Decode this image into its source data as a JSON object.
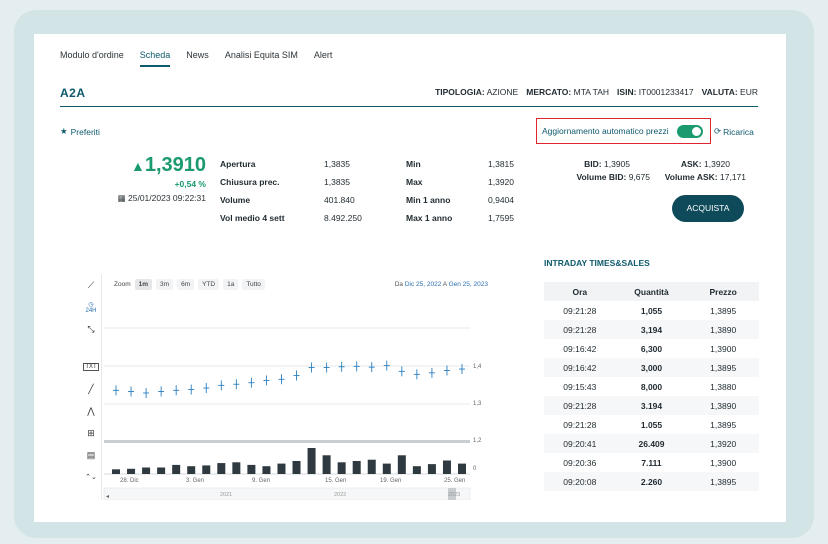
{
  "tabs": [
    "Modulo d'ordine",
    "Scheda",
    "News",
    "Analisi Equita SIM",
    "Alert"
  ],
  "active_tab": "Scheda",
  "close_icon": "close-icon",
  "stock": {
    "name": "A2A",
    "tipologia_label": "TIPOLOGIA:",
    "tipologia": "AZIONE",
    "mercato_label": "MERCATO:",
    "mercato": "MTA TAH",
    "isin_label": "ISIN:",
    "isin": "IT0001233417",
    "valuta_label": "VALUTA:",
    "valuta": "EUR"
  },
  "preferiti": "Preferiti",
  "auto_update_label": "Aggiornamento automatico prezzi",
  "auto_update_on": true,
  "ricarica": "Ricarica",
  "price": {
    "arrow": "▲",
    "value": "1,3910",
    "change": "+0,54 %",
    "timestamp": "25/01/2023 09:22:31"
  },
  "stats": [
    {
      "l1": "Apertura",
      "v1": "1,3835",
      "l2": "Min",
      "v2": "1,3815"
    },
    {
      "l1": "Chiusura prec.",
      "v1": "1,3835",
      "l2": "Max",
      "v2": "1,3920"
    },
    {
      "l1": "Volume",
      "v1": "401.840",
      "l2": "Min 1 anno",
      "v2": "0,9404"
    },
    {
      "l1": "Vol medio 4 sett",
      "v1": "8.492.250",
      "l2": "Max 1 anno",
      "v2": "1,7595"
    }
  ],
  "bidask": {
    "bid_label": "BID:",
    "bid": "1,3905",
    "ask_label": "ASK:",
    "ask": "1,3920",
    "vol_bid_label": "Volume BID:",
    "vol_bid": "9,675",
    "vol_ask_label": "Volume ASK:",
    "vol_ask": "17,171"
  },
  "buy_button": "ACQUISTA",
  "chart": {
    "zoom_label": "Zoom",
    "zoom_options": [
      "1m",
      "3m",
      "6m",
      "YTD",
      "1a",
      "Tutto"
    ],
    "zoom_active": "1m",
    "range_from_label": "Da",
    "range_from": "Dic 25, 2022",
    "range_to_label": "A",
    "range_to": "Gen 25, 2023",
    "tool_24h": "24H",
    "tool_txt": "TXT",
    "y_ticks": [
      "1,4",
      "1,3",
      "1,2"
    ],
    "vol_tick": "0",
    "x_ticks": [
      "28. Dic",
      "3. Gen",
      "9. Gen",
      "15. Gen",
      "19. Gen",
      "25. Gen"
    ],
    "nav_years": [
      "2021",
      "2022",
      "2023"
    ],
    "price_points": [
      1.336,
      1.333,
      1.329,
      1.333,
      1.336,
      1.338,
      1.342,
      1.349,
      1.352,
      1.356,
      1.362,
      1.365,
      1.375,
      1.396,
      1.396,
      1.398,
      1.399,
      1.397,
      1.401,
      1.386,
      1.378,
      1.382,
      1.388,
      1.392
    ],
    "volumes": [
      0.18,
      0.2,
      0.25,
      0.25,
      0.35,
      0.3,
      0.33,
      0.42,
      0.45,
      0.35,
      0.3,
      0.4,
      0.5,
      1.0,
      0.72,
      0.45,
      0.5,
      0.55,
      0.4,
      0.72,
      0.3,
      0.38,
      0.52,
      0.4
    ]
  },
  "intraday": {
    "title": "INTRADAY TIMES&SALES",
    "headers": [
      "Ora",
      "Quantità",
      "Prezzo"
    ],
    "rows": [
      [
        "09:21:28",
        "1,055",
        "1,3895"
      ],
      [
        "09:21:28",
        "3,194",
        "1,3890"
      ],
      [
        "09:16:42",
        "6,300",
        "1,3900"
      ],
      [
        "09:16:42",
        "3,000",
        "1,3895"
      ],
      [
        "09:15:43",
        "8,000",
        "1,3880"
      ],
      [
        "09:21:28",
        "3.194",
        "1,3890"
      ],
      [
        "09:21:28",
        "1.055",
        "1,3895"
      ],
      [
        "09:20:41",
        "26.409",
        "1,3920"
      ],
      [
        "09:20:36",
        "7.111",
        "1,3900"
      ],
      [
        "09:20:08",
        "2.260",
        "1,3895"
      ]
    ]
  }
}
